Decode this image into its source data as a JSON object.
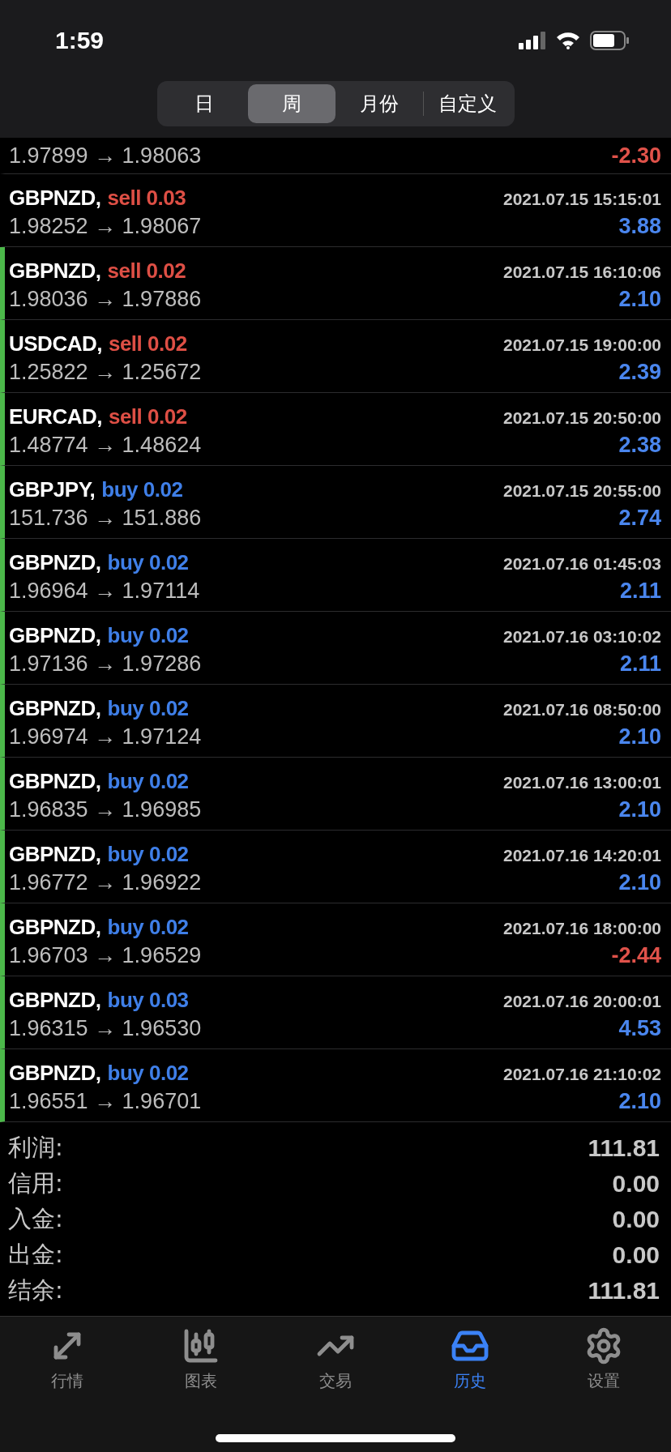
{
  "status_bar": {
    "time": "1:59"
  },
  "segments": [
    {
      "label": "日",
      "selected": false
    },
    {
      "label": "周",
      "selected": true
    },
    {
      "label": "月份",
      "selected": false
    },
    {
      "label": "自定义",
      "selected": false
    }
  ],
  "partial_row": {
    "prices": "1.97899 → 1.98063",
    "profit": {
      "text": "-2.30",
      "kind": "loss"
    }
  },
  "deals": [
    {
      "symbol": "GBPNZD,",
      "order": {
        "text": "sell 0.03",
        "kind": "sell"
      },
      "time": "2021.07.15 15:15:01",
      "prices": "1.98252 → 1.98067",
      "profit": {
        "text": "3.88",
        "kind": "gain"
      },
      "marked": false
    },
    {
      "symbol": "GBPNZD,",
      "order": {
        "text": "sell 0.02",
        "kind": "sell"
      },
      "time": "2021.07.15 16:10:06",
      "prices": "1.98036 → 1.97886",
      "profit": {
        "text": "2.10",
        "kind": "gain"
      },
      "marked": true
    },
    {
      "symbol": "USDCAD,",
      "order": {
        "text": "sell 0.02",
        "kind": "sell"
      },
      "time": "2021.07.15 19:00:00",
      "prices": "1.25822 → 1.25672",
      "profit": {
        "text": "2.39",
        "kind": "gain"
      },
      "marked": true
    },
    {
      "symbol": "EURCAD,",
      "order": {
        "text": "sell 0.02",
        "kind": "sell"
      },
      "time": "2021.07.15 20:50:00",
      "prices": "1.48774 → 1.48624",
      "profit": {
        "text": "2.38",
        "kind": "gain"
      },
      "marked": true
    },
    {
      "symbol": "GBPJPY,",
      "order": {
        "text": "buy 0.02",
        "kind": "buy"
      },
      "time": "2021.07.15 20:55:00",
      "prices": "151.736 → 151.886",
      "profit": {
        "text": "2.74",
        "kind": "gain"
      },
      "marked": true
    },
    {
      "symbol": "GBPNZD,",
      "order": {
        "text": "buy 0.02",
        "kind": "buy"
      },
      "time": "2021.07.16 01:45:03",
      "prices": "1.96964 → 1.97114",
      "profit": {
        "text": "2.11",
        "kind": "gain"
      },
      "marked": true
    },
    {
      "symbol": "GBPNZD,",
      "order": {
        "text": "buy 0.02",
        "kind": "buy"
      },
      "time": "2021.07.16 03:10:02",
      "prices": "1.97136 → 1.97286",
      "profit": {
        "text": "2.11",
        "kind": "gain"
      },
      "marked": true
    },
    {
      "symbol": "GBPNZD,",
      "order": {
        "text": "buy 0.02",
        "kind": "buy"
      },
      "time": "2021.07.16 08:50:00",
      "prices": "1.96974 → 1.97124",
      "profit": {
        "text": "2.10",
        "kind": "gain"
      },
      "marked": true
    },
    {
      "symbol": "GBPNZD,",
      "order": {
        "text": "buy 0.02",
        "kind": "buy"
      },
      "time": "2021.07.16 13:00:01",
      "prices": "1.96835 → 1.96985",
      "profit": {
        "text": "2.10",
        "kind": "gain"
      },
      "marked": true
    },
    {
      "symbol": "GBPNZD,",
      "order": {
        "text": "buy 0.02",
        "kind": "buy"
      },
      "time": "2021.07.16 14:20:01",
      "prices": "1.96772 → 1.96922",
      "profit": {
        "text": "2.10",
        "kind": "gain"
      },
      "marked": true
    },
    {
      "symbol": "GBPNZD,",
      "order": {
        "text": "buy 0.02",
        "kind": "buy"
      },
      "time": "2021.07.16 18:00:00",
      "prices": "1.96703 → 1.96529",
      "profit": {
        "text": "-2.44",
        "kind": "loss"
      },
      "marked": true
    },
    {
      "symbol": "GBPNZD,",
      "order": {
        "text": "buy 0.03",
        "kind": "buy"
      },
      "time": "2021.07.16 20:00:01",
      "prices": "1.96315 → 1.96530",
      "profit": {
        "text": "4.53",
        "kind": "gain"
      },
      "marked": true
    },
    {
      "symbol": "GBPNZD,",
      "order": {
        "text": "buy 0.02",
        "kind": "buy"
      },
      "time": "2021.07.16 21:10:02",
      "prices": "1.96551 → 1.96701",
      "profit": {
        "text": "2.10",
        "kind": "gain"
      },
      "marked": true
    }
  ],
  "summary": [
    {
      "label": "利润:",
      "value": "111.81"
    },
    {
      "label": "信用:",
      "value": "0.00"
    },
    {
      "label": "入金:",
      "value": "0.00"
    },
    {
      "label": "出金:",
      "value": "0.00"
    },
    {
      "label": "结余:",
      "value": "111.81"
    }
  ],
  "tab_bar": [
    {
      "label": "行情",
      "selected": false
    },
    {
      "label": "图表",
      "selected": false
    },
    {
      "label": "交易",
      "selected": false
    },
    {
      "label": "历史",
      "selected": true
    },
    {
      "label": "设置",
      "selected": false
    }
  ]
}
